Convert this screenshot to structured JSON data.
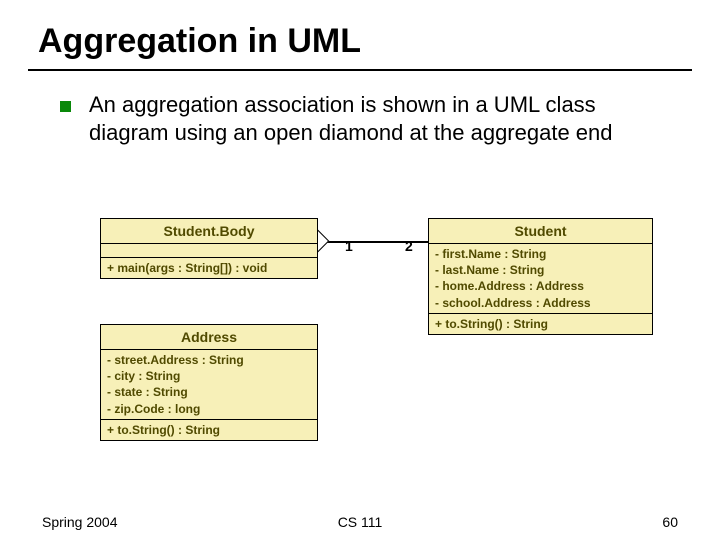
{
  "title": "Aggregation in UML",
  "bullet": "An aggregation association is shown in a UML class diagram using an open diamond at the aggregate end",
  "diagram": {
    "studentBody": {
      "name": "Student.Body",
      "ops": "+ main(args : String[]) : void"
    },
    "student": {
      "name": "Student",
      "attr1": "- first.Name : String",
      "attr2": "- last.Name : String",
      "attr3": "- home.Address : Address",
      "attr4": "- school.Address : Address",
      "op": "+ to.String() : String"
    },
    "address": {
      "name": "Address",
      "attr1": "- street.Address : String",
      "attr2": "- city : String",
      "attr3": "- state : String",
      "attr4": "- zip.Code : long",
      "op": "+ to.String() : String"
    },
    "mult_left": "1",
    "mult_right": "2"
  },
  "footer": {
    "left": "Spring 2004",
    "center": "CS 111",
    "right": "60"
  }
}
